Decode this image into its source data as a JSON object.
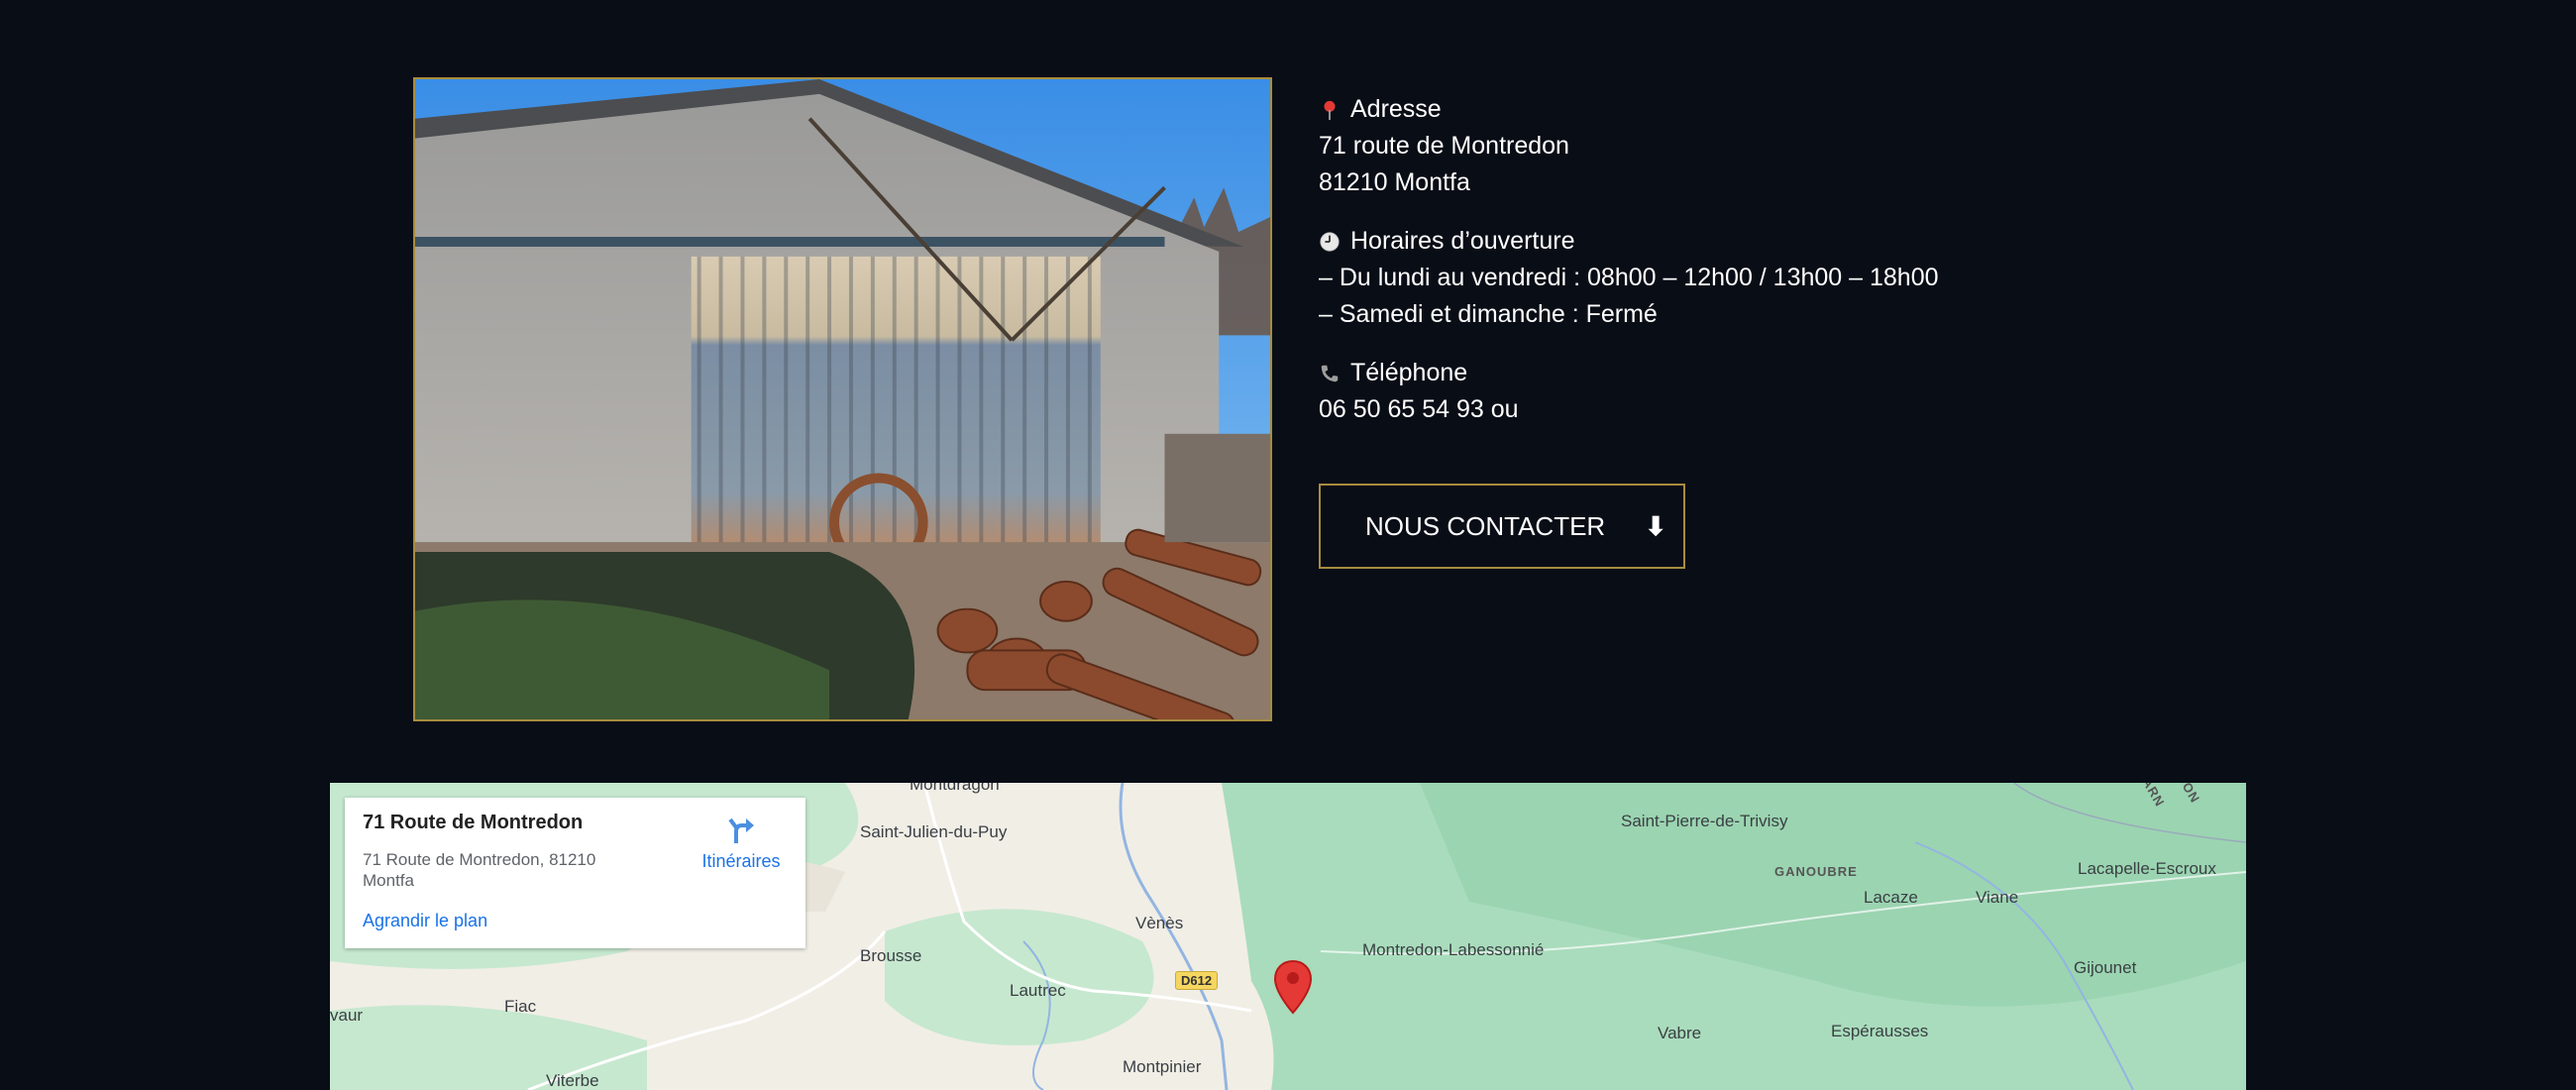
{
  "address": {
    "icon": "pin-icon",
    "heading": "Adresse",
    "line1": "71 route de Montredon",
    "line2": "81210 Montfa"
  },
  "hours": {
    "icon": "clock-icon",
    "heading": "Horaires d’ouverture",
    "line1": "– Du lundi au vendredi : 08h00 – 12h00 / 13h00 – 18h00",
    "line2": "– Samedi et dimanche : Fermé"
  },
  "phone": {
    "icon": "phone-icon",
    "heading": "Téléphone",
    "line1": "06 50 65 54 93 ou"
  },
  "contact_button": {
    "label": "NOUS CONTACTER",
    "arrow": "⬇"
  },
  "map": {
    "card": {
      "title": "71 Route de Montredon",
      "address": "71 Route de Montredon, 81210 Montfa",
      "directions_label": "Itinéraires",
      "enlarge_label": "Agrandir le plan"
    },
    "road_badge": "D612",
    "places": [
      "Montdragon",
      "Saint-Julien-du-Puy",
      "Vènès",
      "Brousse",
      "Lautrec",
      "Fiac",
      "Montpinier",
      "Viterbe",
      "Montredon-Labessonnié",
      "Saint-Pierre-de-Trivisy",
      "GANOUBRE",
      "Lacaze",
      "Viane",
      "Lacapelle-Escroux",
      "Gijounet",
      "Vabre",
      "Espérausses",
      "vaur",
      "ARN",
      "DON"
    ]
  },
  "colors": {
    "background": "#090d16",
    "accent_border": "#a68d3f",
    "map_link": "#1a73e8",
    "pin": "#e53935"
  }
}
